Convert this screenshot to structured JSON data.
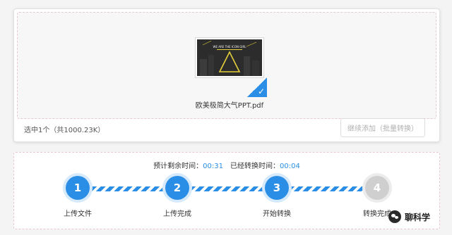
{
  "file": {
    "name": "欧美极简大气PPT.pdf",
    "thumbnail_title": "WE ARE THE ICON GIRL",
    "check_icon": "check-icon"
  },
  "footer": {
    "selected_info": "选中1个（共1000.23K）",
    "continue_label": "继续添加（批量转换）"
  },
  "progress": {
    "remaining_label": "预计剩余时间：",
    "remaining_value": "00:31",
    "elapsed_label": "已经转换时间：",
    "elapsed_value": "00:04",
    "steps": [
      {
        "number": "1",
        "label": "上传文件",
        "state": "done"
      },
      {
        "number": "2",
        "label": "上传完成",
        "state": "done"
      },
      {
        "number": "3",
        "label": "开始转换",
        "state": "done"
      },
      {
        "number": "4",
        "label": "转换完成",
        "state": "pending"
      }
    ]
  },
  "watermark": {
    "text": "聊科学",
    "icon": "wechat-icon"
  },
  "colors": {
    "accent": "#2b8ee6",
    "pending": "#cfcfcf",
    "border_dashed": "#e8c6d4"
  }
}
